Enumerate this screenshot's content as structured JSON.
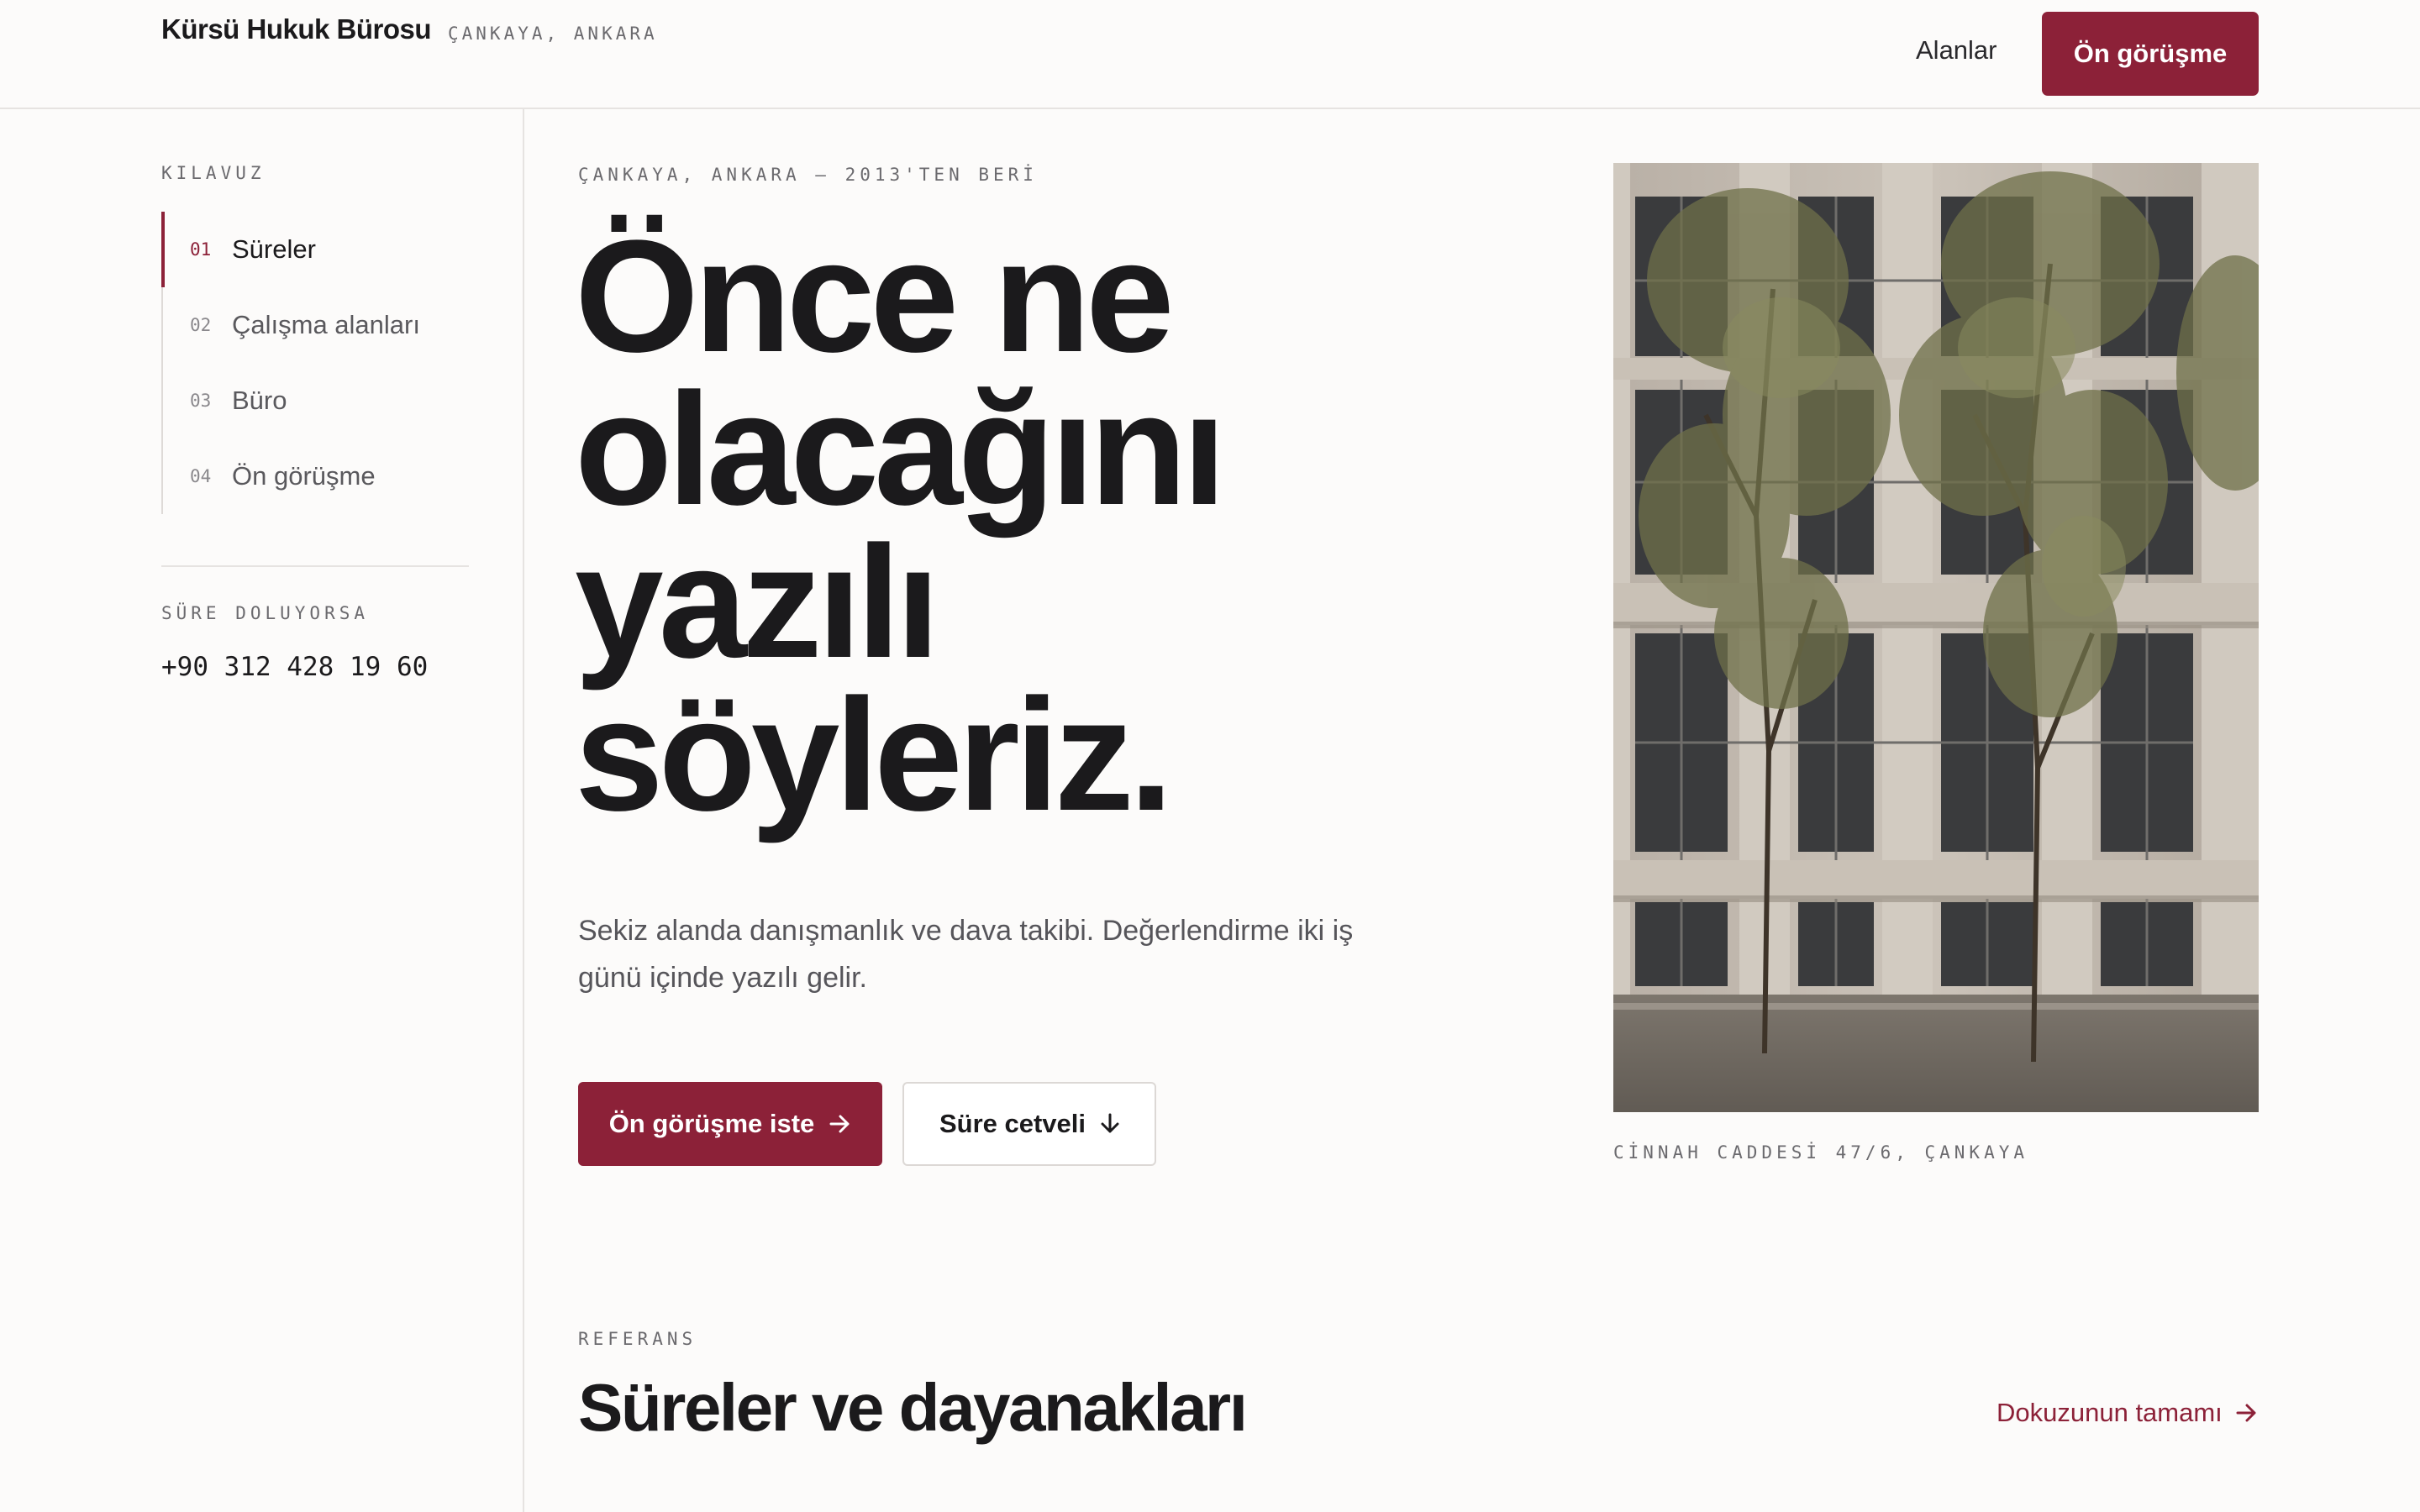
{
  "header": {
    "brand_name": "Kürsü Hukuk Bürosu",
    "brand_location": "ÇANKAYA, ANKARA",
    "nav_link": "Alanlar",
    "cta_label": "Ön görüşme"
  },
  "sidebar": {
    "guide_title": "KILAVUZ",
    "items": [
      {
        "num": "01",
        "label": "Süreler",
        "active": true
      },
      {
        "num": "02",
        "label": "Çalışma alanları",
        "active": false
      },
      {
        "num": "03",
        "label": "Büro",
        "active": false
      },
      {
        "num": "04",
        "label": "Ön görüşme",
        "active": false
      }
    ],
    "overflow_title": "SÜRE DOLUYORSA",
    "phone": "+90 312 428 19 60"
  },
  "hero": {
    "eyebrow": "ÇANKAYA, ANKARA — 2013'TEN BERİ",
    "title_lines": [
      "Önce ne",
      "olacağını",
      "yazılı",
      "söyleriz."
    ],
    "lede": "Sekiz alanda danışmanlık ve dava takibi. Değerlendirme iki iş günü içinde yazılı gelir.",
    "primary_button": "Ön görüşme iste",
    "primary_icon": "arrow-right-icon",
    "secondary_button": "Süre cetveli",
    "secondary_icon": "arrow-down-icon"
  },
  "photo": {
    "caption": "CİNNAH CADDESİ 47/6, ÇANKAYA"
  },
  "references": {
    "eyebrow": "REFERANS",
    "title": "Süreler ve dayanakları",
    "link_label": "Dokuzunun tamamı",
    "link_icon": "arrow-right-icon"
  },
  "colors": {
    "accent": "#8c2138",
    "background": "#fcfbfa",
    "text": "#1b1a1c",
    "muted": "#6b6a6e"
  }
}
